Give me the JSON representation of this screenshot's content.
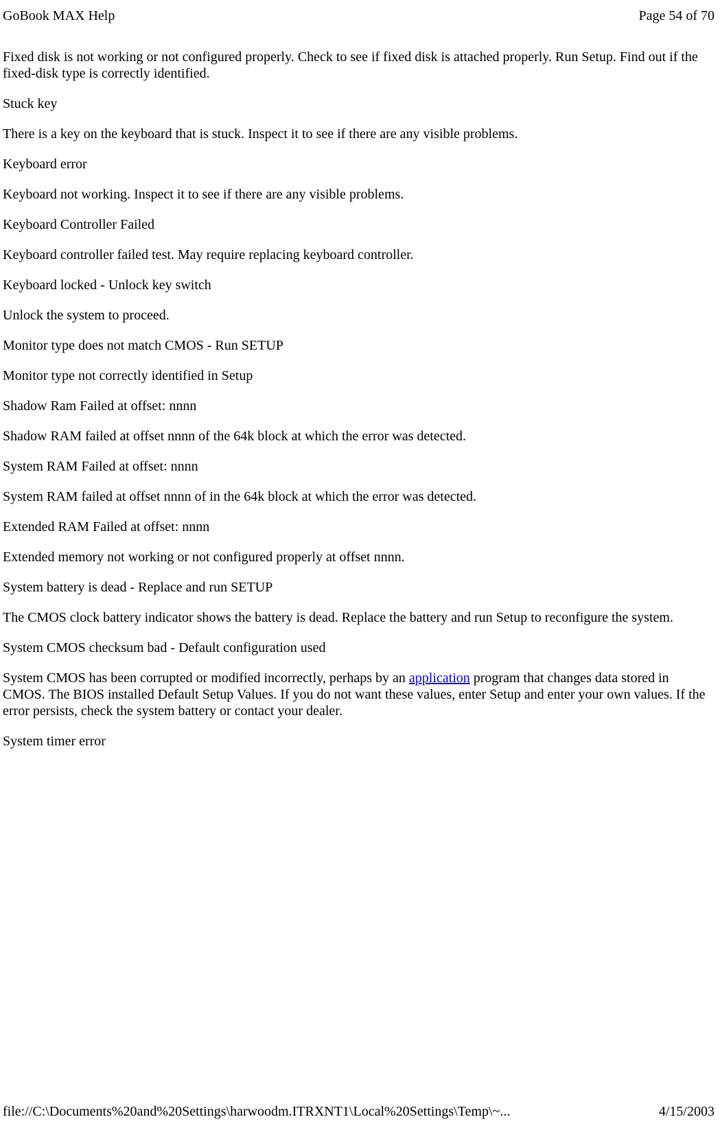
{
  "header": {
    "title": "GoBook MAX Help",
    "page_indicator": "Page 54 of 70"
  },
  "body": {
    "p1": "Fixed disk is not working or not configured properly. Check to see if fixed disk is attached properly. Run Setup. Find out if the fixed-disk type is correctly identified.",
    "p2": "Stuck key",
    "p3": "There is a key on the keyboard that is stuck.  Inspect it to see if there are any visible problems.",
    "p4": "Keyboard error",
    "p5": "Keyboard not working.  Inspect it to see if there are any visible problems.",
    "p6": "Keyboard Controller Failed",
    "p7": "Keyboard controller failed test. May require replacing keyboard controller.",
    "p8": "Keyboard locked - Unlock key switch",
    "p9": "Unlock the system to proceed.",
    "p10": "Monitor type does not match CMOS - Run SETUP",
    "p11": "Monitor type not correctly identified in Setup",
    "p12": "Shadow Ram Failed at offset: nnnn",
    "p13": "Shadow RAM failed at offset nnnn of the 64k block at which the error was detected.",
    "p14": "System RAM Failed at offset: nnnn",
    "p15": "System RAM failed at offset nnnn of in the 64k block at which the error was detected.",
    "p16": "Extended RAM Failed at offset: nnnn",
    "p17": "Extended memory not working or not configured properly at offset nnnn.",
    "p18": "System battery is dead - Replace and run SETUP",
    "p19": "The CMOS clock battery indicator shows the battery is dead. Replace the battery and run Setup to reconfigure the system.",
    "p20": "System CMOS checksum bad - Default configuration used",
    "p21_before": "System CMOS has been corrupted or modified incorrectly, perhaps by an ",
    "p21_link": "application",
    "p21_after": " program that changes data stored in CMOS. The BIOS installed Default Setup Values. If you do not want these values, enter Setup and enter your own values. If the error persists, check the system battery or contact your dealer.",
    "p22": "System timer error"
  },
  "footer": {
    "path": "file://C:\\Documents%20and%20Settings\\harwoodm.ITRXNT1\\Local%20Settings\\Temp\\~...",
    "date": "4/15/2003"
  }
}
